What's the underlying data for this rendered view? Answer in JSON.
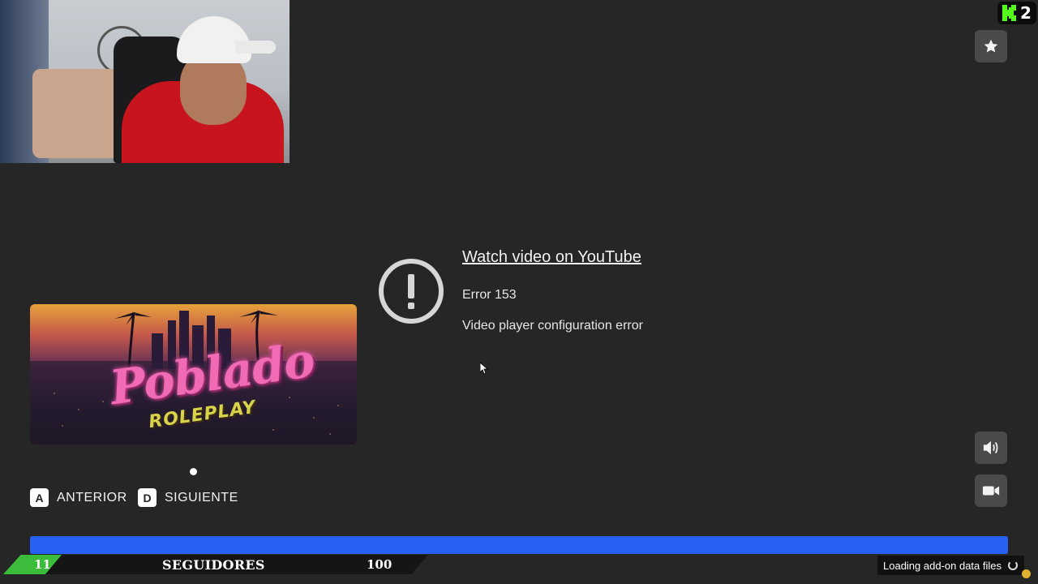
{
  "overlay": {
    "kick_count": "2",
    "youtube": {
      "link_text": "Watch video on YouTube",
      "error_code": "Error 153",
      "error_message": "Video player configuration error"
    },
    "banner": {
      "title": "Poblado",
      "subtitle": "ROLEPLAY"
    },
    "carousel": {
      "prev_key": "A",
      "prev_label": "ANTERIOR",
      "next_key": "D",
      "next_label": "SIGUIENTE",
      "page_indicator": 1
    },
    "followers": {
      "current": "11",
      "label": "SEGUIDORES",
      "goal": "100"
    },
    "loading_text": "Loading add-on data files",
    "progress_fraction": 1.0,
    "icons": [
      "star-icon",
      "volume-icon",
      "video-camera-icon",
      "error-icon",
      "kick-logo-icon"
    ],
    "colors": {
      "background": "#262626",
      "progress": "#1e50e3",
      "follower_green": "#3bbd3b",
      "kick_green": "#53fc18"
    }
  }
}
